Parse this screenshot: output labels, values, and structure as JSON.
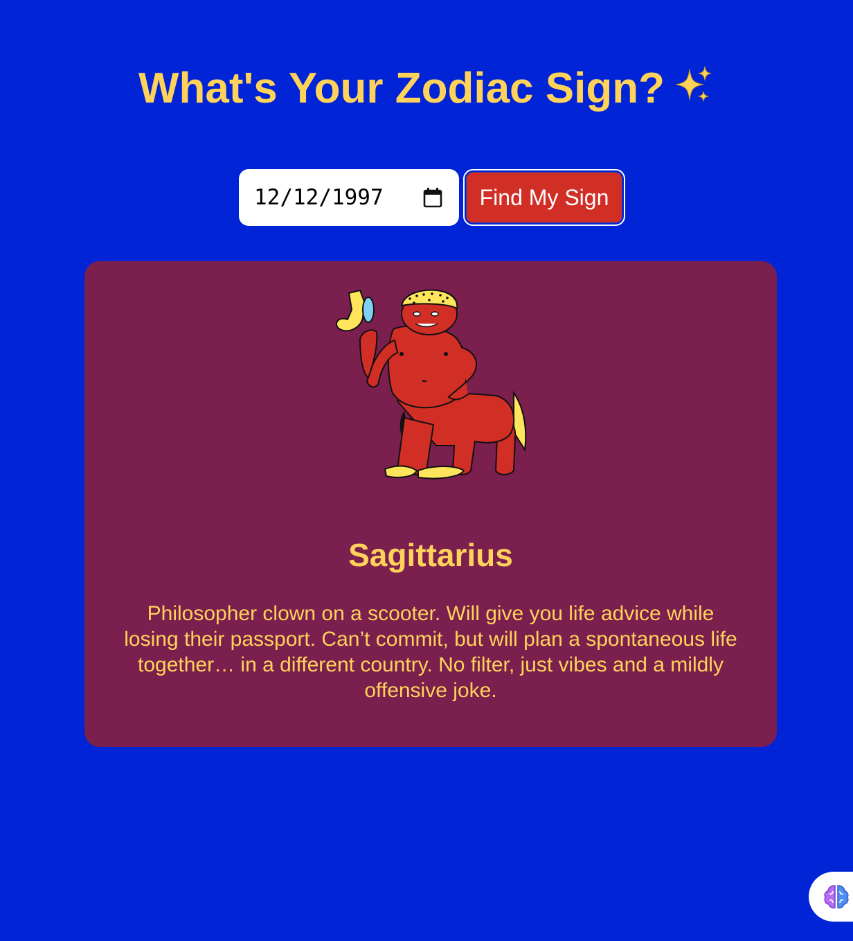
{
  "header": {
    "title": "What's Your Zodiac Sign?",
    "title_icon": "sparkles-icon"
  },
  "form": {
    "date_value": "12/12/1997",
    "date_icon": "calendar-icon",
    "submit_label": "Find My Sign"
  },
  "result": {
    "sign_name": "Sagittarius",
    "description": "Philosopher clown on a scooter. Will give you life advice while losing their passport. Can’t commit, but will plan a spontaneous life together… in a different country. No filter, just vibes and a mildly offensive joke.",
    "illustration": "sagittarius-centaur-illustration"
  },
  "floating_button": {
    "icon": "brain-icon"
  },
  "colors": {
    "background": "#0024d6",
    "accent_text": "#ffd35a",
    "card": "#7a1f4e",
    "button": "#d12e26"
  }
}
